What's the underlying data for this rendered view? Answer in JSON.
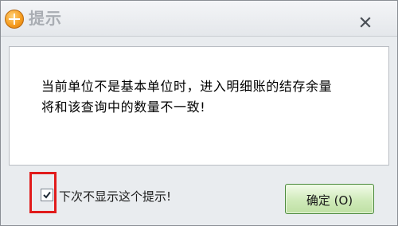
{
  "window": {
    "title": "提示",
    "icon": "app-logo-icon",
    "close_icon": "close-icon"
  },
  "message": {
    "line1": "当前单位不是基本单位时，进入明细账的结存余量",
    "line2": "将和该查询中的数量不一致!"
  },
  "footer": {
    "checkbox_checked": true,
    "checkbox_label": "下次不显示这个提示!",
    "ok_label": "确定 (O)"
  },
  "colors": {
    "highlight_box": "#e11b1b",
    "button_fill": "#cfeab9",
    "button_border": "#4b8a3c"
  }
}
